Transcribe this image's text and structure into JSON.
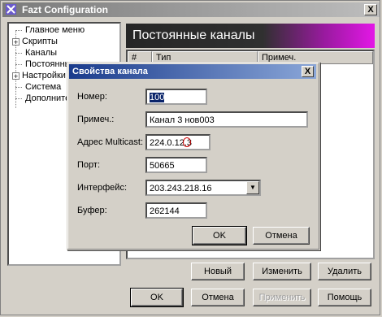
{
  "window": {
    "title": "Fazt Configuration",
    "close_glyph": "X"
  },
  "tree": {
    "items": [
      {
        "label": "Главное меню",
        "expander": ""
      },
      {
        "label": "Скрипты",
        "expander": "+"
      },
      {
        "label": "Каналы",
        "expander": ""
      },
      {
        "label": "Постоянные каналы",
        "expander": ""
      },
      {
        "label": "Настройки",
        "expander": "+"
      },
      {
        "label": "Система",
        "expander": ""
      },
      {
        "label": "Дополнительно",
        "expander": ""
      }
    ]
  },
  "panel": {
    "header": "Постоянные каналы",
    "columns": [
      "#",
      "Тип",
      "Примеч."
    ],
    "buttons": {
      "new": "Новый",
      "edit": "Изменить",
      "delete": "Удалить"
    }
  },
  "footer": {
    "ok": "OK",
    "cancel": "Отмена",
    "apply": "Применить",
    "help": "Помощь"
  },
  "dialog": {
    "title": "Свойства канала",
    "close_glyph": "X",
    "fields": {
      "number": {
        "label": "Номер:",
        "value": "100"
      },
      "note": {
        "label": "Примеч.:",
        "value": "Канал 3 нов003"
      },
      "multicast": {
        "label": "Адрес Multicast:",
        "value": "224.0.12.3"
      },
      "port": {
        "label": "Порт:",
        "value": "50665"
      },
      "interface": {
        "label": "Интерфейс:",
        "value": "203.243.218.16"
      },
      "buffer": {
        "label": "Буфер:",
        "value": "262144"
      }
    },
    "ok": "OK",
    "cancel": "Отмена"
  },
  "colors": {
    "header_accent": "#e317e6",
    "dialog_title": "#1a3b8c"
  }
}
